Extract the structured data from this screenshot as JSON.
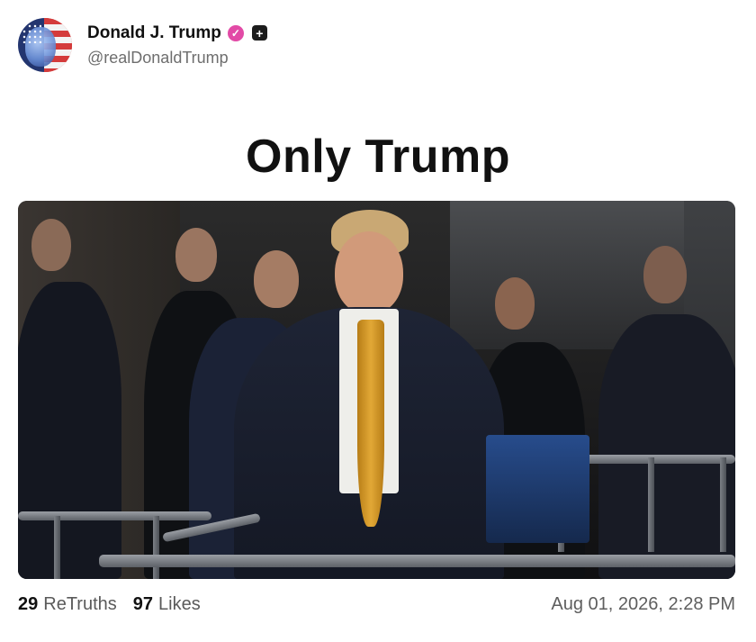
{
  "author": {
    "display_name": "Donald J. Trump",
    "handle": "@realDonaldTrump",
    "avatar_icon": "avatar-image",
    "verified_icon": "verified-badge-icon",
    "plus_icon": "plus-badge-icon"
  },
  "post": {
    "title": "Only Trump",
    "image_icon": "photo"
  },
  "footer": {
    "retruths_count": "29",
    "retruths_label": "ReTruths",
    "likes_count": "97",
    "likes_label": "Likes",
    "timestamp": "Aug 01, 2026, 2:28 PM"
  },
  "colors": {
    "verified": "#e24aa6",
    "text_primary": "#111111",
    "text_secondary": "#6e6e6e",
    "tie": "#d79a1f"
  }
}
